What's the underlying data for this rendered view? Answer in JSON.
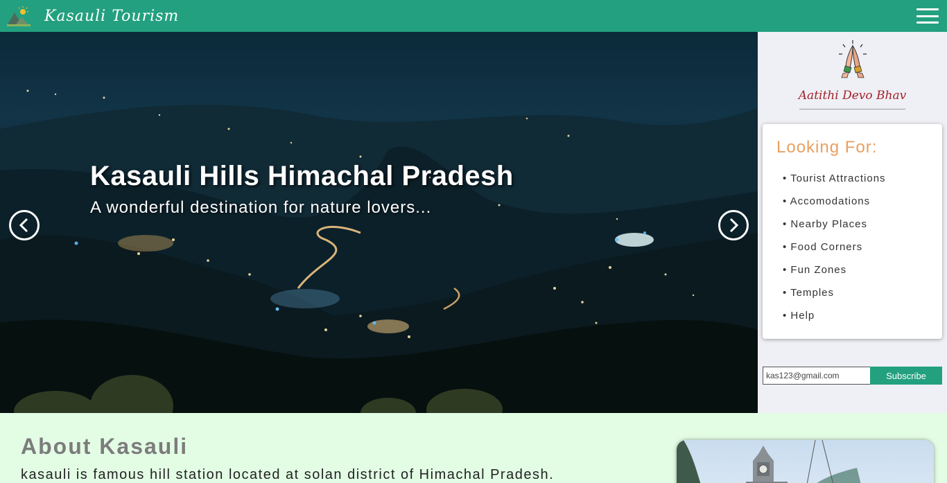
{
  "header": {
    "brand": "Kasauli Tourism",
    "logo_icon": "mountain-sun-icon",
    "menu_icon": "hamburger-menu-icon"
  },
  "hero": {
    "title": "Kasauli Hills Himachal Pradesh",
    "subtitle": "A wonderful destination for nature lovers...",
    "prev_icon": "chevron-left-icon",
    "next_icon": "chevron-right-icon"
  },
  "sidebar": {
    "greeting_icon": "namaste-hands-icon",
    "greeting": "Aatithi Devo Bhav",
    "card_title": "Looking For:",
    "items": [
      "Tourist Attractions",
      "Accomodations",
      "Nearby Places",
      "Food Corners",
      "Fun Zones",
      "Temples",
      "Help"
    ],
    "subscribe": {
      "value": "kas123@gmail.com",
      "button": "Subscribe"
    }
  },
  "about": {
    "title": "About Kasauli",
    "text": "kasauli is famous hill station located at solan district of Himachal Pradesh."
  },
  "colors": {
    "accent": "#23a07f",
    "greeting": "#a3212b",
    "card_title": "#e8a060",
    "about_bg": "#e3fde5"
  }
}
